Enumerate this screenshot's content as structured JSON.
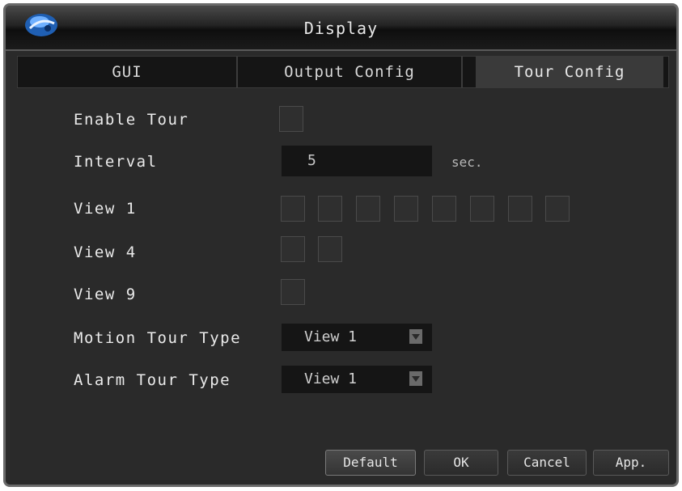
{
  "window": {
    "title": "Display",
    "logo_icon": "dvr-logo-icon"
  },
  "tabs": [
    {
      "label": "GUI",
      "active": false
    },
    {
      "label": "Output Config",
      "active": false
    },
    {
      "label": "Tour Config",
      "active": true
    }
  ],
  "form": {
    "enable_tour": {
      "label": "Enable Tour",
      "checked": false
    },
    "interval": {
      "label": "Interval",
      "value": "5",
      "unit": "sec."
    },
    "view1": {
      "label": "View 1",
      "checkbox_count": 8
    },
    "view4": {
      "label": "View 4",
      "checkbox_count": 2
    },
    "view9": {
      "label": "View 9",
      "checkbox_count": 1
    },
    "motion_tour_type": {
      "label": "Motion Tour Type",
      "value": "View 1"
    },
    "alarm_tour_type": {
      "label": "Alarm Tour Type",
      "value": "View 1"
    }
  },
  "buttons": {
    "default": "Default",
    "ok": "OK",
    "cancel": "Cancel",
    "apply": "App."
  },
  "colors": {
    "background": "#2a2a2a",
    "field": "#151515",
    "text": "#eaeaea"
  }
}
